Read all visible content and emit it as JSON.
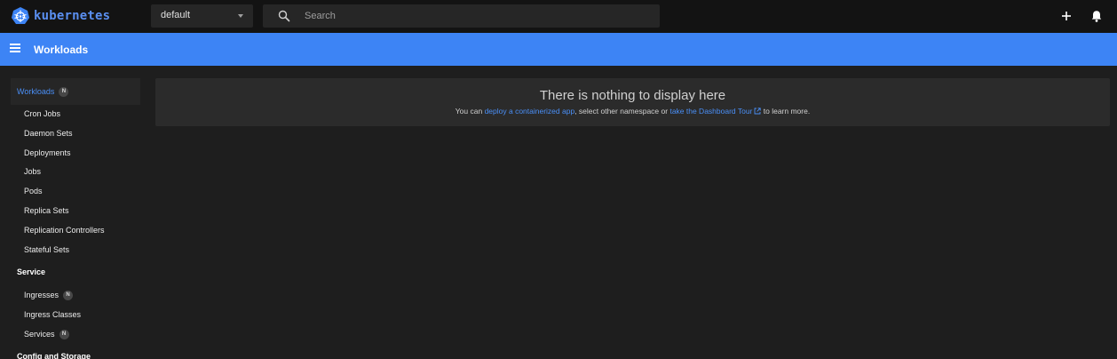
{
  "brand": {
    "name": "kubernetes",
    "logo_icon": "kubernetes-helm-icon",
    "color": "#5a8ff0"
  },
  "namespace": {
    "value": "default"
  },
  "search": {
    "placeholder": "Search",
    "icon": "search-icon"
  },
  "toolbar": {
    "create_icon": "plus-icon",
    "notifications_icon": "bell-icon"
  },
  "header": {
    "title": "Workloads",
    "color": "#3d84f5",
    "menu_icon": "hamburger-menu-icon"
  },
  "sidebar": {
    "workloads": {
      "label": "Workloads",
      "badge": "N"
    },
    "workload_items": [
      {
        "label": "Cron Jobs"
      },
      {
        "label": "Daemon Sets"
      },
      {
        "label": "Deployments"
      },
      {
        "label": "Jobs"
      },
      {
        "label": "Pods"
      },
      {
        "label": "Replica Sets"
      },
      {
        "label": "Replication Controllers"
      },
      {
        "label": "Stateful Sets"
      }
    ],
    "service": {
      "label": "Service"
    },
    "service_items": [
      {
        "label": "Ingresses",
        "badge": "N"
      },
      {
        "label": "Ingress Classes"
      },
      {
        "label": "Services",
        "badge": "N"
      }
    ],
    "config": {
      "label": "Config and Storage"
    }
  },
  "empty_state": {
    "title": "There is nothing to display here",
    "prefix": "You can ",
    "deploy_link": "deploy a containerized app",
    "middle": ", select other namespace or ",
    "tour_link": "take the Dashboard Tour",
    "suffix": " to learn more.",
    "link_color": "#4a8ff7"
  }
}
